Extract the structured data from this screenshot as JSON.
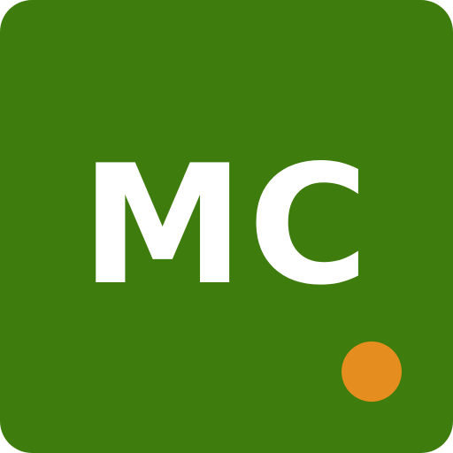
{
  "avatar": {
    "initials": "MC",
    "background_color": "#3f7c0e",
    "text_color": "#ffffff"
  },
  "status_indicator": {
    "color": "#e58e1f"
  }
}
